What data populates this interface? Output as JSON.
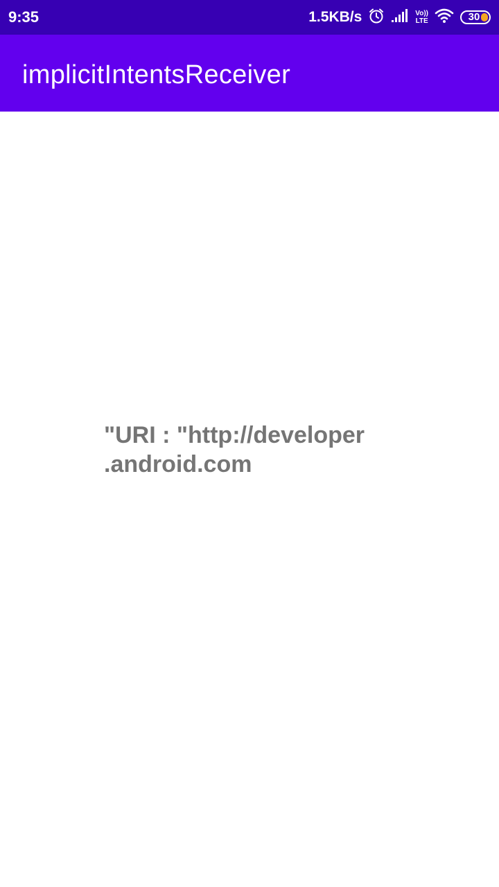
{
  "status_bar": {
    "time": "9:35",
    "net_speed": "1.5KB/s",
    "volte_top": "Vo))",
    "volte_bottom": "LTE",
    "battery_level": "30",
    "icons": [
      "alarm-icon",
      "signal-icon",
      "volte-icon",
      "wifi-icon",
      "battery-icon"
    ],
    "colors": {
      "background": "#3700b3",
      "battery_fill": "#f5a623"
    }
  },
  "app_bar": {
    "title": "implicitIntentsReceiver",
    "color": "#6200ee"
  },
  "main": {
    "uri_line1": "\"URI : \"http://developer",
    "uri_line2": ".android.com",
    "text_color": "#757575"
  }
}
